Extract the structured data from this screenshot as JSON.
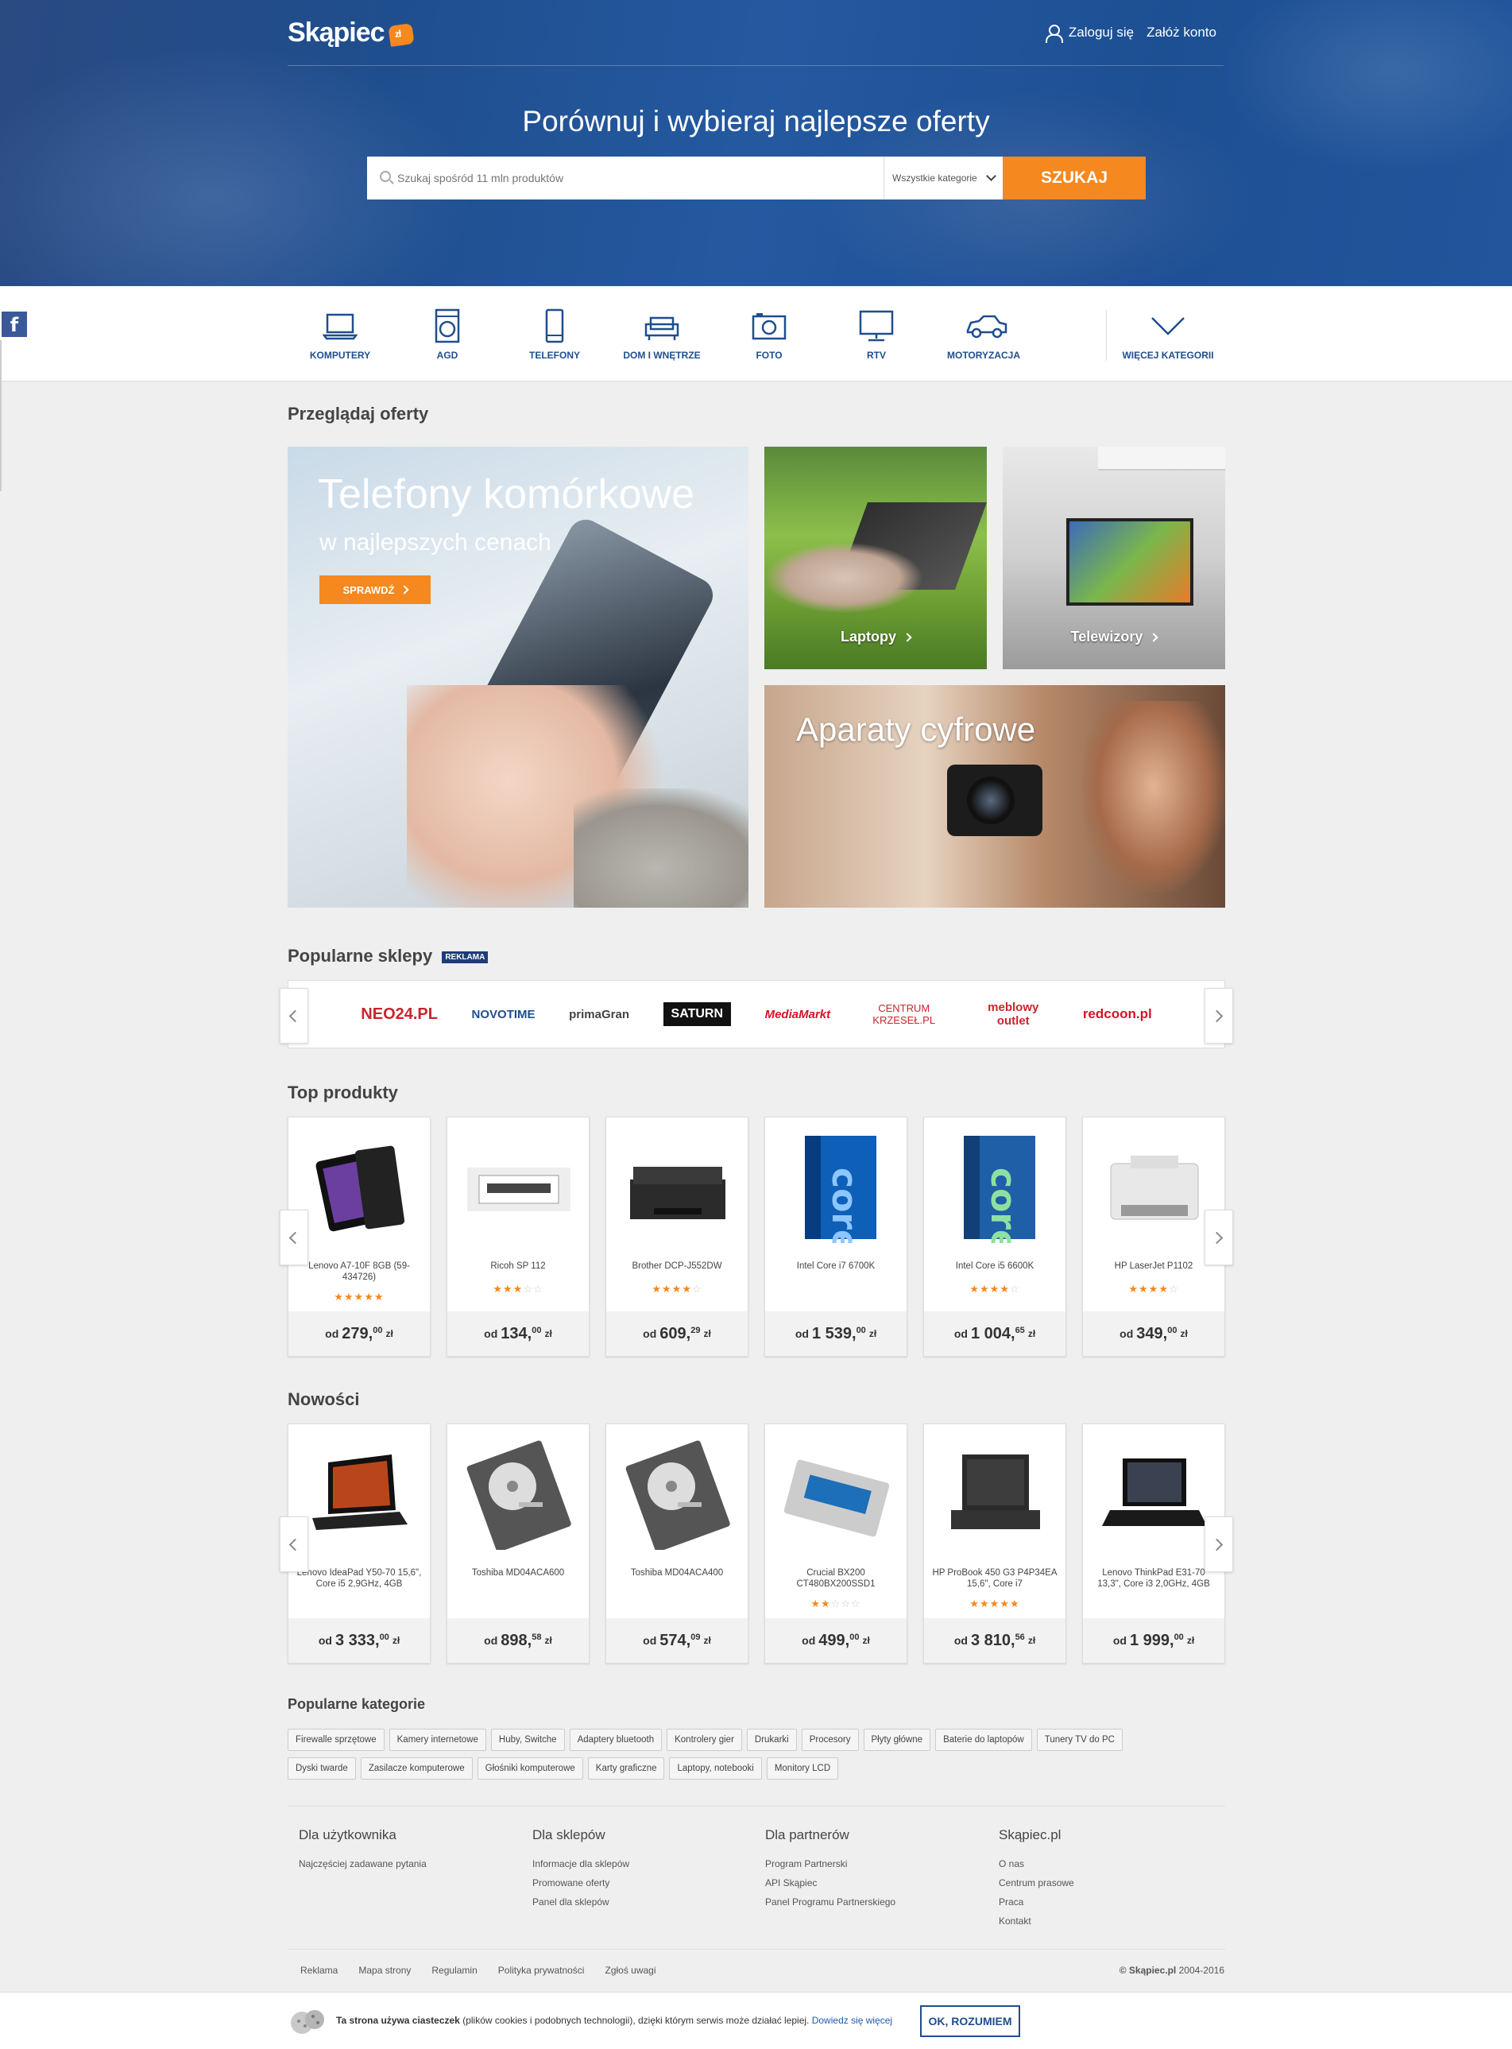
{
  "header": {
    "logo_text": "Skąpiec",
    "login": "Zaloguj się",
    "register": "Załóż konto",
    "title": "Porównuj i wybieraj najlepsze oferty",
    "search_placeholder": "Szukaj spośród 11 mln produktów",
    "search_category": "Wszystkie kategorie",
    "search_button": "SZUKAJ"
  },
  "categories": [
    {
      "label": "KOMPUTERY",
      "icon": "monitor-laptop-icon"
    },
    {
      "label": "AGD",
      "icon": "washing-machine-icon"
    },
    {
      "label": "TELEFONY",
      "icon": "phone-icon"
    },
    {
      "label": "DOM I WNĘTRZE",
      "icon": "sofa-icon"
    },
    {
      "label": "FOTO",
      "icon": "camera-icon"
    },
    {
      "label": "RTV",
      "icon": "tv-icon"
    },
    {
      "label": "MOTORYZACJA",
      "icon": "car-icon"
    },
    {
      "label": "WIĘCEJ KATEGORII",
      "icon": "chevron-down-icon"
    }
  ],
  "browse": {
    "title": "Przeglądaj oferty",
    "big_title": "Telefony komórkowe",
    "big_subtitle": "w najlepszych cenach",
    "big_button": "SPRAWDŹ",
    "laptops": "Laptopy",
    "tvs": "Telewizory",
    "cameras": "Aparaty cyfrowe"
  },
  "shops": {
    "title": "Popularne sklepy",
    "badge": "REKLAMA",
    "items": [
      "NEO24.PL",
      "NOVOTIME",
      "primaGran",
      "SATURN",
      "MediaMarkt",
      "CENTRUM KRZESEŁ.PL",
      "meblowy outlet",
      "redcoon.pl"
    ]
  },
  "top": {
    "title": "Top produkty",
    "items": [
      {
        "name": "Lenovo A7-10F 8GB (59-434726)",
        "stars": 5,
        "od": "od",
        "price": "279,",
        "dec": "00",
        "cur": "zł"
      },
      {
        "name": "Ricoh SP 112",
        "stars": 3,
        "od": "od",
        "price": "134,",
        "dec": "00",
        "cur": "zł"
      },
      {
        "name": "Brother DCP-J552DW",
        "stars": 4,
        "od": "od",
        "price": "609,",
        "dec": "29",
        "cur": "zł"
      },
      {
        "name": "Intel Core i7 6700K",
        "stars": 0,
        "od": "od",
        "price": "1 539,",
        "dec": "00",
        "cur": "zł"
      },
      {
        "name": "Intel Core i5 6600K",
        "stars": 4,
        "od": "od",
        "price": "1 004,",
        "dec": "65",
        "cur": "zł"
      },
      {
        "name": "HP LaserJet P1102",
        "stars": 4,
        "od": "od",
        "price": "349,",
        "dec": "00",
        "cur": "zł"
      }
    ]
  },
  "new": {
    "title": "Nowości",
    "items": [
      {
        "name": "Lenovo IdeaPad Y50-70 15,6\", Core i5 2,9GHz, 4GB",
        "stars": 0,
        "od": "od",
        "price": "3 333,",
        "dec": "00",
        "cur": "zł"
      },
      {
        "name": "Toshiba MD04ACA600",
        "stars": 0,
        "od": "od",
        "price": "898,",
        "dec": "58",
        "cur": "zł"
      },
      {
        "name": "Toshiba MD04ACA400",
        "stars": 0,
        "od": "od",
        "price": "574,",
        "dec": "09",
        "cur": "zł"
      },
      {
        "name": "Crucial BX200 CT480BX200SSD1",
        "stars": 2,
        "od": "od",
        "price": "499,",
        "dec": "00",
        "cur": "zł"
      },
      {
        "name": "HP ProBook 450 G3 P4P34EA 15,6\", Core i7",
        "stars": 5,
        "od": "od",
        "price": "3 810,",
        "dec": "56",
        "cur": "zł"
      },
      {
        "name": "Lenovo ThinkPad E31-70 13,3\", Core i3 2,0GHz, 4GB",
        "stars": 0,
        "od": "od",
        "price": "1 999,",
        "dec": "00",
        "cur": "zł"
      }
    ]
  },
  "popular_categories": {
    "title": "Popularne kategorie",
    "items": [
      "Firewalle sprzętowe",
      "Kamery internetowe",
      "Huby, Switche",
      "Adaptery bluetooth",
      "Kontrolery gier",
      "Drukarki",
      "Procesory",
      "Płyty główne",
      "Baterie do laptopów",
      "Tunery TV do PC",
      "Dyski twarde",
      "Zasilacze komputerowe",
      "Głośniki komputerowe",
      "Karty graficzne",
      "Laptopy, notebooki",
      "Monitory LCD"
    ]
  },
  "footer": {
    "cols": [
      {
        "title": "Dla użytkownika",
        "links": [
          "Najczęściej zadawane pytania"
        ]
      },
      {
        "title": "Dla sklepów",
        "links": [
          "Informacje dla sklepów",
          "Promowane oferty",
          "Panel dla sklepów"
        ]
      },
      {
        "title": "Dla partnerów",
        "links": [
          "Program Partnerski",
          "API Skąpiec",
          "Panel Programu Partnerskiego"
        ]
      },
      {
        "title": "Skąpiec.pl",
        "links": [
          "O nas",
          "Centrum prasowe",
          "Praca",
          "Kontakt"
        ]
      }
    ],
    "bottom_links": [
      "Reklama",
      "Mapa strony",
      "Regulamin",
      "Polityka prywatności",
      "Zgłoś uwagi"
    ],
    "copyright_brand": "© Skąpiec.pl",
    "copyright_years": "2004-2016"
  },
  "cookie": {
    "bold": "Ta strona używa ciasteczek",
    "text": " (plików cookies i podobnych technologii), dzięki którym serwis może działać lepiej. ",
    "link": "Dowiedz się więcej",
    "button": "OK, ROZUMIEM"
  },
  "colors": {
    "brand_blue": "#1f4e8e",
    "accent_orange": "#f5881f"
  }
}
